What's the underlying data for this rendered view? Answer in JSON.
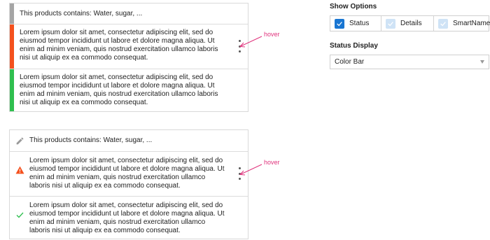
{
  "colors": {
    "bar_neutral": "#a5a5a5",
    "bar_warning": "#f4511e",
    "bar_success": "#2fbf4f",
    "warning_icon": "#f4511e",
    "success_icon": "#2fbf4f",
    "pencil_icon": "#9a9a9a",
    "accent": "#1976d2",
    "checkbox_unchecked": "#cfe3f6",
    "annotation": "#e0337d"
  },
  "panel_bar": {
    "rows": [
      {
        "status": "neutral",
        "text": "This products contains: Water, sugar, ..."
      },
      {
        "status": "warning",
        "text": "Lorem ipsum dolor sit amet, consectetur adipiscing elit, sed do eiusmod tempor incididunt ut labore et dolore magna aliqua. Ut enim ad minim veniam, quis nostrud exercitation ullamco laboris nisi ut aliquip ex ea commodo consequat."
      },
      {
        "status": "success",
        "text": "Lorem ipsum dolor sit amet, consectetur adipiscing elit, sed do eiusmod tempor incididunt ut labore et dolore magna aliqua. Ut enim ad minim veniam, quis nostrud exercitation ullamco laboris nisi ut aliquip ex ea commodo consequat."
      }
    ]
  },
  "panel_icon": {
    "rows": [
      {
        "icon": "pencil-icon",
        "text": "This products contains: Water, sugar, ..."
      },
      {
        "icon": "warning-icon",
        "text": "Lorem ipsum dolor sit amet, consectetur adipiscing elit, sed do eiusmod tempor incididunt ut labore et dolore magna aliqua. Ut enim ad minim veniam, quis nostrud exercitation ullamco laboris nisi ut aliquip ex ea commodo consequat."
      },
      {
        "icon": "check-icon",
        "text": "Lorem ipsum dolor sit amet, consectetur adipiscing elit, sed do eiusmod tempor incididunt ut labore et dolore magna aliqua. Ut enim ad minim veniam, quis nostrud exercitation ullamco laboris nisi ut aliquip ex ea commodo consequat."
      }
    ]
  },
  "annotations": {
    "hover_top": "hover",
    "hover_bottom": "hover"
  },
  "show_options": {
    "title": "Show Options",
    "items": [
      {
        "label": "Status",
        "checked": true
      },
      {
        "label": "Details",
        "checked": false
      },
      {
        "label": "SmartNames",
        "checked": false
      }
    ]
  },
  "status_display": {
    "title": "Status Display",
    "selected": "Color Bar"
  }
}
